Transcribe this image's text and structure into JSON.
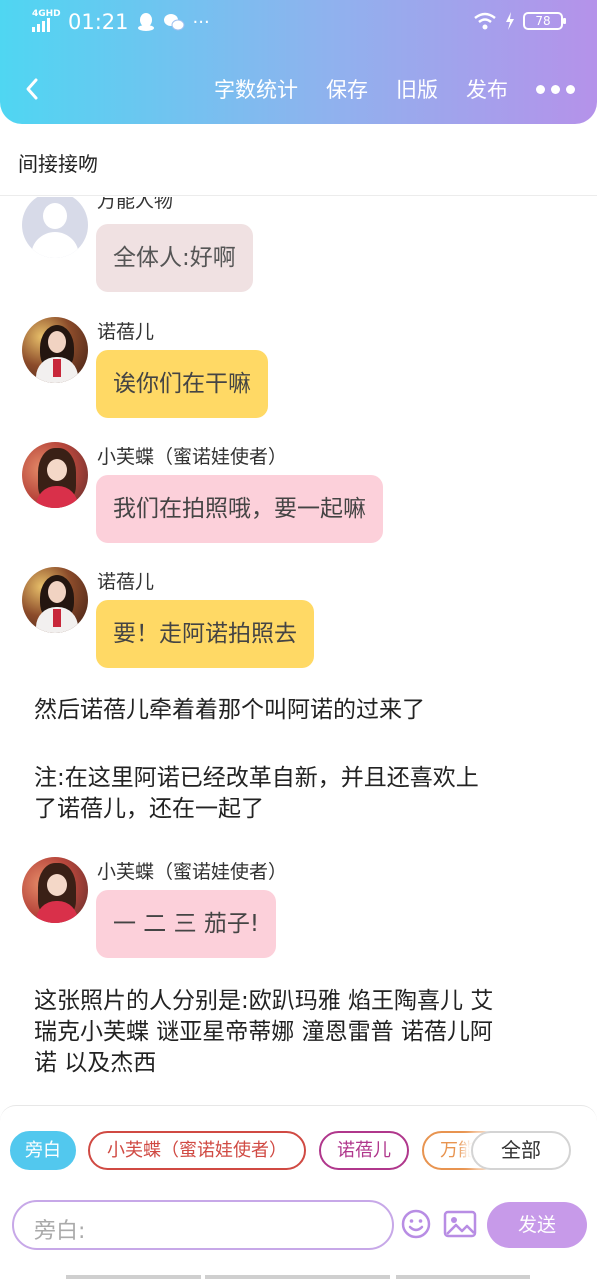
{
  "status_bar": {
    "network": "4GHD",
    "time": "01:21",
    "battery": "78"
  },
  "nav": {
    "actions": [
      "字数统计",
      "保存",
      "旧版",
      "发布"
    ]
  },
  "page_title": "间接接吻",
  "messages": [
    {
      "type": "chat",
      "speaker": "万能人物",
      "avatar": "generic-person-icon",
      "text": "全体人:好啊",
      "color": "#f0e1e2"
    },
    {
      "type": "chat",
      "speaker": "诺蓓儿",
      "avatar": "nuobeier-avatar",
      "text": "诶你们在干嘛",
      "color": "#ffd965"
    },
    {
      "type": "chat",
      "speaker": "小芙蝶（蜜诺娃使者）",
      "avatar": "xiaofudie-avatar",
      "text": "我们在拍照哦，要一起嘛",
      "color": "#fcd0da"
    },
    {
      "type": "chat",
      "speaker": "诺蓓儿",
      "avatar": "nuobeier-avatar",
      "text": "要！走阿诺拍照去",
      "color": "#ffd965"
    },
    {
      "type": "narration",
      "text": "然后诺蓓儿牵着着那个叫阿诺的过来了"
    },
    {
      "type": "narration",
      "lines": [
        "注:在这里阿诺已经改革自新，并且还喜欢上",
        "了诺蓓儿，还在一起了"
      ]
    },
    {
      "type": "chat",
      "speaker": "小芙蝶（蜜诺娃使者）",
      "avatar": "xiaofudie-avatar",
      "text": "一 二 三 茄子!",
      "color": "#fcd0da"
    },
    {
      "type": "narration",
      "lines": [
        "这张照片的人分别是:欧趴玛雅 焰王陶喜儿 艾",
        "瑞克小芙蝶 谜亚星帝蒂娜 潼恩雷普 诺蓓儿阿",
        "诺 以及杰西"
      ]
    }
  ],
  "roles": [
    "旁白",
    "小芙蝶（蜜诺娃使者）",
    "诺蓓儿",
    "万能",
    "全部"
  ],
  "input": {
    "placeholder": "旁白:",
    "send_label": "发送"
  },
  "colors": {
    "header_start": "#4fd6f2",
    "header_end": "#b592ea",
    "send_button": "#c79ae9",
    "active_chip": "#52c8ee"
  }
}
